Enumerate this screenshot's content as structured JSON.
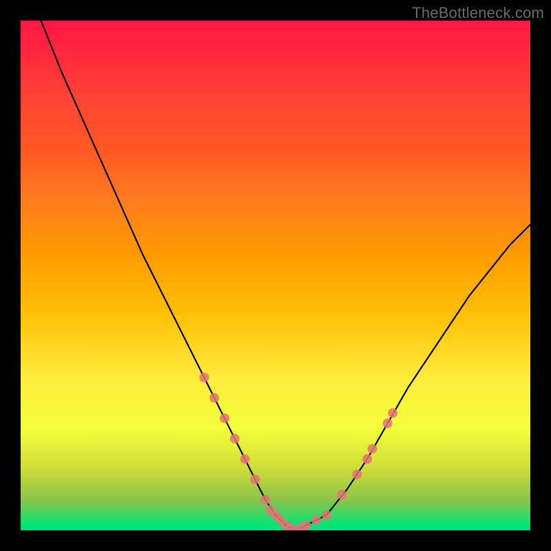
{
  "watermark": "TheBottleneck.com",
  "chart_data": {
    "type": "line",
    "title": "",
    "xlabel": "",
    "ylabel": "",
    "xlim": [
      0,
      100
    ],
    "ylim": [
      0,
      100
    ],
    "grid": false,
    "legend": false,
    "background_gradient": {
      "direction": "vertical",
      "stops": [
        {
          "pos": 0,
          "color": "#ff1744"
        },
        {
          "pos": 25,
          "color": "#ff5722"
        },
        {
          "pos": 50,
          "color": "#ffc107"
        },
        {
          "pos": 75,
          "color": "#ffeb3b"
        },
        {
          "pos": 100,
          "color": "#00e676"
        }
      ]
    },
    "series": [
      {
        "name": "bottleneck-curve",
        "x": [
          0,
          4,
          8,
          12,
          16,
          20,
          24,
          28,
          32,
          36,
          40,
          44,
          48,
          50,
          52,
          54,
          56,
          60,
          64,
          68,
          72,
          76,
          80,
          84,
          88,
          92,
          96,
          100
        ],
        "values": [
          110,
          100,
          90,
          81,
          72,
          63,
          54,
          46,
          38,
          30,
          22,
          14,
          6,
          3,
          1,
          0,
          1,
          3,
          8,
          14,
          21,
          28,
          34,
          40,
          46,
          51,
          56,
          60
        ]
      }
    ],
    "markers": {
      "name": "highlight-points",
      "color": "#e57373",
      "points": [
        {
          "x": 36,
          "y": 30
        },
        {
          "x": 38,
          "y": 26
        },
        {
          "x": 40,
          "y": 22
        },
        {
          "x": 42,
          "y": 18
        },
        {
          "x": 44,
          "y": 14
        },
        {
          "x": 46,
          "y": 10
        },
        {
          "x": 48,
          "y": 6
        },
        {
          "x": 49,
          "y": 4
        },
        {
          "x": 50,
          "y": 3
        },
        {
          "x": 51,
          "y": 2
        },
        {
          "x": 52,
          "y": 1
        },
        {
          "x": 53,
          "y": 0.5
        },
        {
          "x": 54,
          "y": 0
        },
        {
          "x": 55,
          "y": 0.5
        },
        {
          "x": 56,
          "y": 1
        },
        {
          "x": 58,
          "y": 2
        },
        {
          "x": 60,
          "y": 3
        },
        {
          "x": 63,
          "y": 7
        },
        {
          "x": 66,
          "y": 11
        },
        {
          "x": 68,
          "y": 14
        },
        {
          "x": 69,
          "y": 16
        },
        {
          "x": 72,
          "y": 21
        },
        {
          "x": 73,
          "y": 23
        }
      ]
    }
  }
}
